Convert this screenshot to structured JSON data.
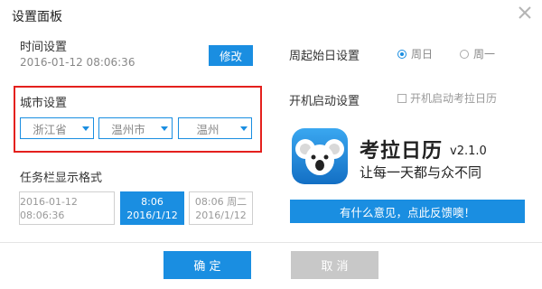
{
  "dialog": {
    "title": "设置面板"
  },
  "time": {
    "label": "时间设置",
    "value": "2016-01-12 08:06:36",
    "modify_label": "修改"
  },
  "city": {
    "label": "城市设置",
    "province": "浙江省",
    "city": "温州市",
    "district": "温州"
  },
  "taskbar": {
    "label": "任务栏显示格式",
    "formats": [
      {
        "line1": "2016-01-12 08:06:36",
        "line2": ""
      },
      {
        "line1": "8:06",
        "line2": "2016/1/12"
      },
      {
        "line1": "08:06 周二",
        "line2": "2016/1/12"
      }
    ]
  },
  "week": {
    "label": "周起始日设置",
    "options": [
      "周日",
      "周一"
    ],
    "selected": "周日"
  },
  "boot": {
    "label": "开机启动设置",
    "checkbox_label": "开机启动考拉日历"
  },
  "about": {
    "name": "考拉日历",
    "version": "v2.1.0",
    "slogan": "让每一天都与众不同",
    "feedback_label": "有什么意见，点此反馈噢！"
  },
  "footer": {
    "ok_label": "确 定",
    "cancel_label": "取 消"
  },
  "colors": {
    "accent": "#1a8ee1",
    "highlight_border": "#e4201d",
    "disabled": "#c8c8c8"
  },
  "icons": {
    "close": "close-icon",
    "logo": "koala-logo-icon",
    "caret": "chevron-down-icon"
  }
}
